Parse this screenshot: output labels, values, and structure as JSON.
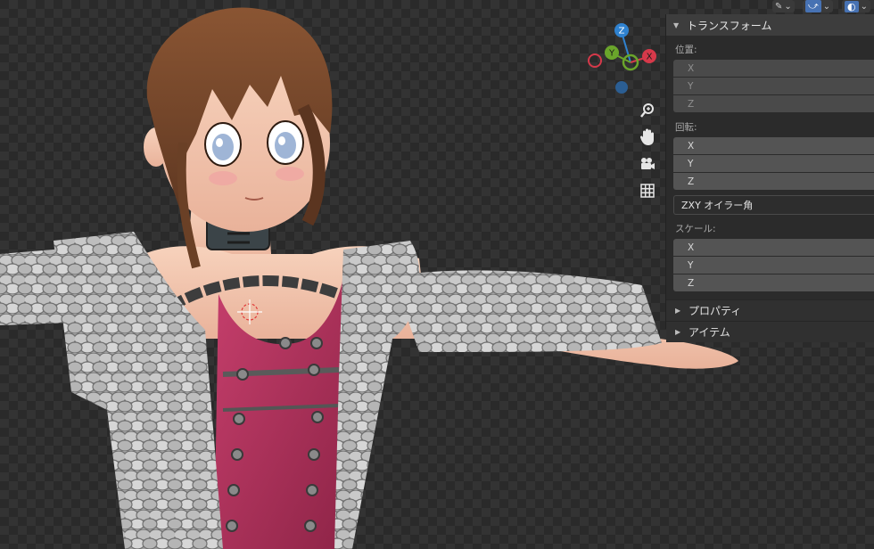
{
  "panel": {
    "transform_title": "トランスフォーム",
    "location_label": "位置:",
    "location_fields": [
      "X",
      "Y",
      "Z"
    ],
    "rotation_label": "回転:",
    "rotation_fields": [
      "X",
      "Y",
      "Z"
    ],
    "rotation_mode": "ZXY オイラー角",
    "scale_label": "スケール:",
    "scale_fields": [
      "X",
      "Y",
      "Z"
    ],
    "properties_title": "プロパティ",
    "item_title": "アイテム"
  },
  "gizmo": {
    "z_label": "Z",
    "y_label": "Y",
    "x_label": "X",
    "colors": {
      "x": "#d6394a",
      "y": "#6aa52b",
      "z": "#2f82d0"
    }
  },
  "nav_icons": [
    "zoom-icon",
    "hand-pan-icon",
    "camera-icon",
    "grid-icon"
  ]
}
